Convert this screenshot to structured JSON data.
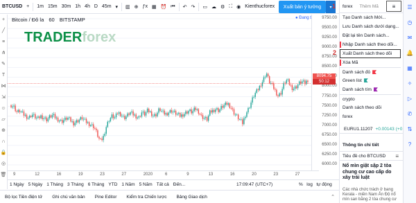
{
  "toolbar": {
    "symbol": "BTCUSD",
    "add_icon": "plus-icon",
    "timeframes": [
      "1m",
      "15m",
      "30m",
      "1h",
      "4h",
      "D",
      "45m"
    ],
    "active_timeframe": "1h",
    "idea_user": "Kienthucforex",
    "publish_label": "Xuất bản ý tưởng"
  },
  "chart": {
    "title_parts": [
      "Bitcoin / Đô la",
      "60",
      "BITSTAMP"
    ],
    "logo_main": "TRADER",
    "logo_fx": "forex",
    "open_badge": "● Đang tả",
    "price_labels": [
      "9750.00",
      "9500.00",
      "9250.00",
      "9000.00",
      "8750.00",
      "8500.00",
      "8250.00",
      "8000.00",
      "7750.00",
      "7500.00",
      "7250.00",
      "7000.00",
      "6750.00",
      "6500.00",
      "6250.00",
      "6000.00"
    ],
    "last_price": "8094.75",
    "last_price_sub": "50:12",
    "time_labels": [
      "9",
      "12",
      "16",
      "19",
      "23",
      "27",
      "2020",
      "6",
      "9",
      "13",
      "16",
      "20",
      "23",
      "27"
    ],
    "colors": {
      "up": "#26a69a",
      "down": "#ef5350",
      "last_line": "#ef5350",
      "accent": "#2962ff"
    }
  },
  "chart_data": {
    "type": "candlestick",
    "symbol": "BTCUSD",
    "interval": "60",
    "ylim": [
      5700,
      10000
    ],
    "close_path": [
      7500,
      7450,
      7300,
      7350,
      7250,
      7200,
      7150,
      7250,
      7180,
      7120,
      7200,
      7150,
      7100,
      7180,
      7220,
      7150,
      7100,
      7050,
      7100,
      7150,
      7080,
      7000,
      7050,
      7100,
      7150,
      7050,
      7000,
      6950,
      6900,
      6700,
      6500,
      6600,
      6900,
      7100,
      7200,
      7150,
      7300,
      7250,
      7150,
      7200,
      7300,
      7250,
      7200,
      7150,
      7300,
      7250,
      7350,
      7300,
      7200,
      7250,
      7400,
      7300,
      7250,
      7300,
      7350,
      7300,
      7250,
      7200,
      7250,
      7300,
      7350,
      7300,
      7400,
      7350,
      7200,
      7150,
      7100,
      7300,
      7350,
      7400,
      7350,
      7450,
      7500,
      7550,
      7450,
      7300,
      7200,
      7100,
      7000,
      7250,
      7400,
      7600,
      7800,
      7900,
      8050,
      8200,
      8400,
      8150,
      8050,
      7900,
      7750,
      7850,
      8100,
      8200,
      8050,
      7950,
      8000,
      8100,
      8150,
      8100,
      8200
    ]
  },
  "range_bar": {
    "ranges": [
      "1 Ngày",
      "5 Ngày",
      "1 Tháng",
      "3 Tháng",
      "6 Tháng",
      "YTD",
      "1 Năm",
      "5 Năm",
      "Tất cả",
      "Đến..."
    ],
    "clock": "17:09:47 (UTC+7)",
    "right_opts": [
      "%",
      "log",
      "tự động"
    ]
  },
  "tabs": [
    "Bộ lọc Tiền điện tử",
    "Ghi chú văn bản",
    "Pine Editor",
    "Kiểm tra Chiến lược",
    "Bảng Giao dịch"
  ],
  "right_panel": {
    "header_tab": "forex",
    "header_add": "Thêm Mã",
    "annotation_1": "1",
    "annotation_2": "2",
    "menu_items": [
      {
        "label": "Tạo Danh sách Mới...",
        "flag": ""
      },
      {
        "label": "Lưu Danh sách dưới dạng...",
        "flag": ""
      },
      {
        "label": "Đặt lại tên Danh sách...",
        "flag": ""
      },
      {
        "label": "Nhập Danh sách theo dõi...",
        "flag": ""
      },
      {
        "label": "Xuất Danh sách theo dõi",
        "flag": ""
      },
      {
        "label": "Xóa Mã",
        "flag": ""
      },
      {
        "label": "Danh sách đỏ",
        "flag": "red"
      },
      {
        "label": "Green list",
        "flag": "green"
      },
      {
        "label": "Danh sách tím",
        "flag": "purple"
      },
      {
        "label": "crypto",
        "flag": ""
      },
      {
        "label": "Danh sách theo dõi",
        "flag": ""
      },
      {
        "label": "forex",
        "flag": ""
      }
    ],
    "ticker": {
      "symbol": "EURU1.1120",
      "suffix": "7",
      "change": "+0.00143",
      "pct": "(+0."
    },
    "info_title": "Thông tin chi tiết",
    "details_label": "Tiêu đề cho BTCUSD",
    "news_title": "Nổ mìn giật sập 2 tòa chung cư cao cấp do xây trái luật",
    "news_body": "Các nhà chức trách ở bang Kerala - miền Nam Ấn Độ nổ mìn san bằng 2 tòa chung cư"
  },
  "icons": [
    "list-icon",
    "clock-icon",
    "chat-icon",
    "bell-icon",
    "calendar-icon",
    "ideas-icon",
    "streams-icon",
    "chats-icon",
    "trade-icon",
    "help-icon"
  ]
}
